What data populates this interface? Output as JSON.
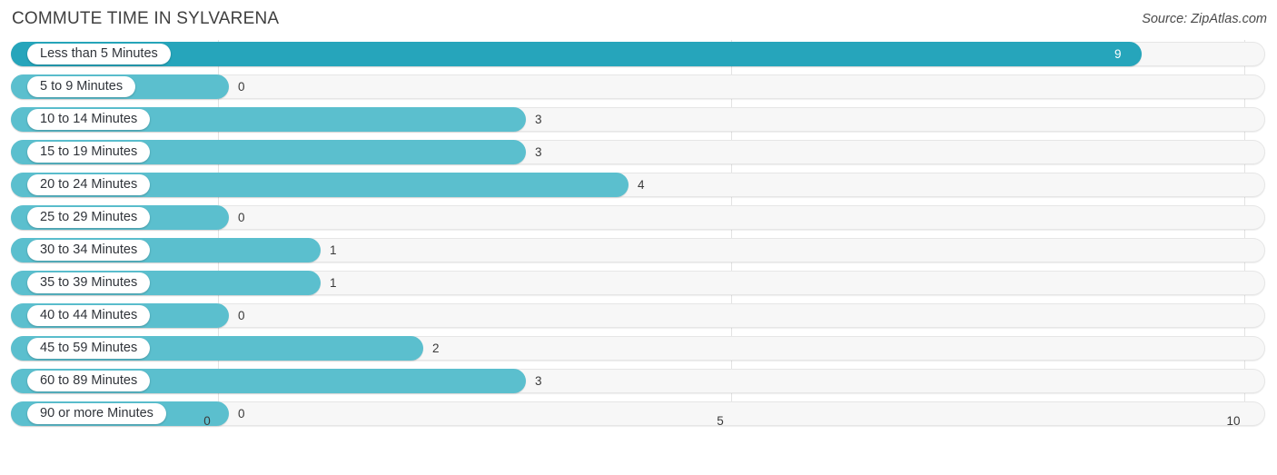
{
  "header": {
    "title": "COMMUTE TIME IN SYLVARENA",
    "source": "Source: ZipAtlas.com"
  },
  "colors": {
    "bar_primary": "#26a5bb",
    "bar_secondary": "#5bbfce",
    "track": "#f7f7f7",
    "gridline": "#e3e3e3",
    "text": "#3a3a3a"
  },
  "chart_data": {
    "type": "bar",
    "orientation": "horizontal",
    "title": "COMMUTE TIME IN SYLVARENA",
    "xlabel": "",
    "ylabel": "",
    "xlim": [
      0,
      10
    ],
    "xticks": [
      "0",
      "5",
      "10"
    ],
    "xtick_values": [
      0,
      5,
      10
    ],
    "grid": true,
    "legend": "none",
    "categories": [
      "Less than 5 Minutes",
      "5 to 9 Minutes",
      "10 to 14 Minutes",
      "15 to 19 Minutes",
      "20 to 24 Minutes",
      "25 to 29 Minutes",
      "30 to 34 Minutes",
      "35 to 39 Minutes",
      "40 to 44 Minutes",
      "45 to 59 Minutes",
      "60 to 89 Minutes",
      "90 or more Minutes"
    ],
    "values": [
      9,
      0,
      3,
      3,
      4,
      0,
      1,
      1,
      0,
      2,
      3,
      0
    ],
    "value_labels": [
      "9",
      "0",
      "3",
      "3",
      "4",
      "0",
      "1",
      "1",
      "0",
      "2",
      "3",
      "0"
    ]
  }
}
